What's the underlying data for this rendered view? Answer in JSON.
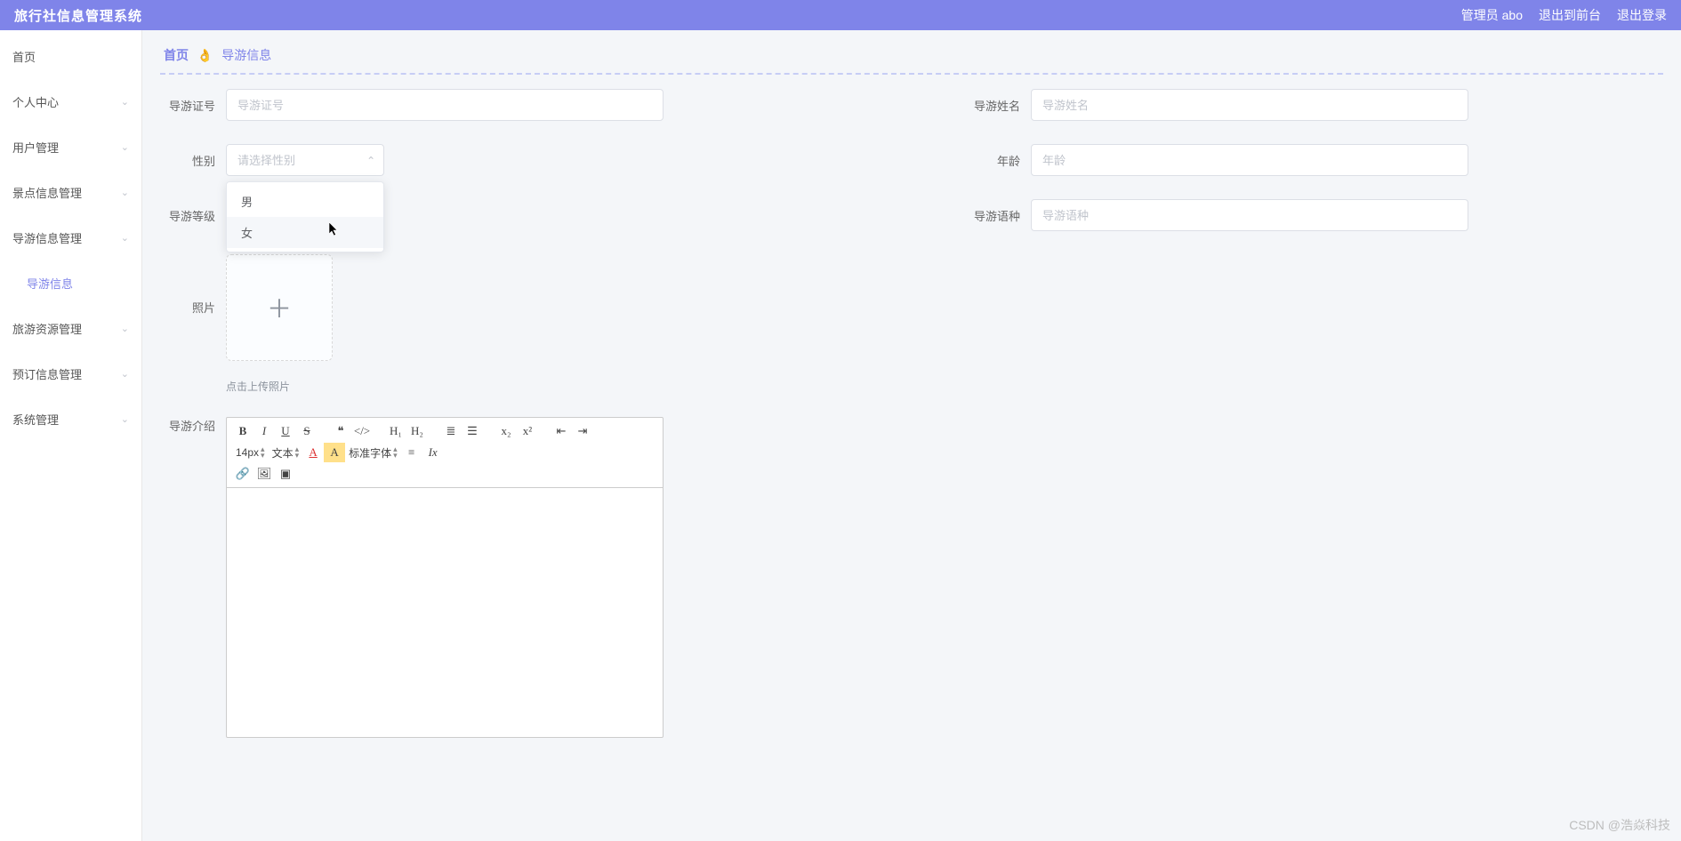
{
  "header": {
    "brand": "旅行社信息管理系统",
    "admin_label": "管理员 abo",
    "exit_front_label": "退出到前台",
    "logout_label": "退出登录"
  },
  "sidebar": {
    "items": [
      {
        "label": "首页",
        "expandable": false
      },
      {
        "label": "个人中心",
        "expandable": true
      },
      {
        "label": "用户管理",
        "expandable": true
      },
      {
        "label": "景点信息管理",
        "expandable": true
      },
      {
        "label": "导游信息管理",
        "expandable": true,
        "children": [
          {
            "label": "导游信息"
          }
        ]
      },
      {
        "label": "旅游资源管理",
        "expandable": true
      },
      {
        "label": "预订信息管理",
        "expandable": true
      },
      {
        "label": "系统管理",
        "expandable": true
      }
    ]
  },
  "breadcrumb": {
    "home": "首页",
    "icon": "👌",
    "current": "导游信息"
  },
  "form": {
    "guide_id": {
      "label": "导游证号",
      "placeholder": "导游证号"
    },
    "guide_name": {
      "label": "导游姓名",
      "placeholder": "导游姓名"
    },
    "gender": {
      "label": "性别",
      "placeholder": "请选择性别",
      "options": [
        "男",
        "女"
      ]
    },
    "age": {
      "label": "年龄",
      "placeholder": "年龄"
    },
    "level": {
      "label": "导游等级"
    },
    "language": {
      "label": "导游语种",
      "placeholder": "导游语种"
    },
    "photo": {
      "label": "照片",
      "hint": "点击上传照片"
    },
    "intro": {
      "label": "导游介绍"
    }
  },
  "editor_toolbar": {
    "font_size": "14px",
    "text_type": "文本",
    "font_family": "标准字体"
  },
  "watermark": "CSDN @浩焱科技"
}
